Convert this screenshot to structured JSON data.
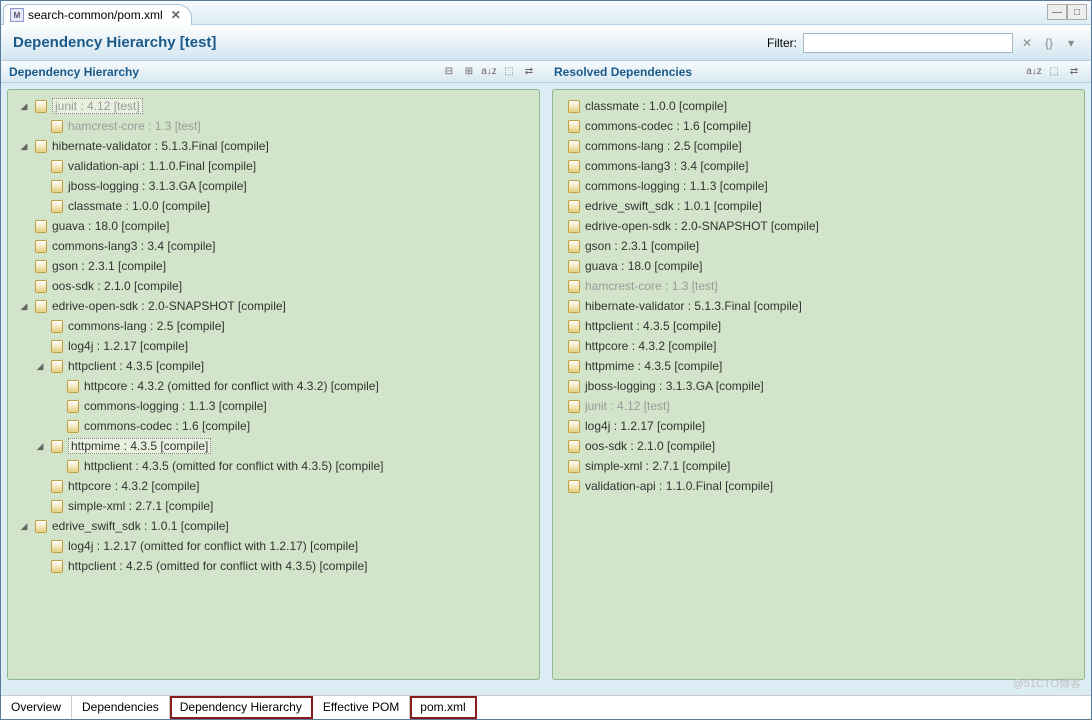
{
  "tab": {
    "icon": "M",
    "name": "search-common/pom.xml",
    "close": "✕"
  },
  "window": {
    "min": "—",
    "max": "□"
  },
  "title": "Dependency Hierarchy [test]",
  "filter": {
    "label": "Filter:",
    "value": "",
    "placeholder": ""
  },
  "filter_icons": [
    "✕",
    "{}",
    "▾"
  ],
  "left": {
    "title": "Dependency Hierarchy",
    "tools": [
      "⊟",
      "⊞",
      "a↓z",
      "⬚",
      "⇄"
    ],
    "tree": [
      {
        "t": "◢",
        "i": 0,
        "l": "junit : 4.12 [test]",
        "g": true,
        "sel": true
      },
      {
        "t": "",
        "i": 1,
        "l": "hamcrest-core : 1.3 [test]",
        "g": true
      },
      {
        "t": "◢",
        "i": 0,
        "l": "hibernate-validator : 5.1.3.Final [compile]"
      },
      {
        "t": "",
        "i": 1,
        "l": "validation-api : 1.1.0.Final [compile]"
      },
      {
        "t": "",
        "i": 1,
        "l": "jboss-logging : 3.1.3.GA [compile]"
      },
      {
        "t": "",
        "i": 1,
        "l": "classmate : 1.0.0 [compile]"
      },
      {
        "t": "",
        "i": 0,
        "l": "guava : 18.0 [compile]"
      },
      {
        "t": "",
        "i": 0,
        "l": "commons-lang3 : 3.4 [compile]"
      },
      {
        "t": "",
        "i": 0,
        "l": "gson : 2.3.1 [compile]"
      },
      {
        "t": "",
        "i": 0,
        "l": "oos-sdk : 2.1.0 [compile]"
      },
      {
        "t": "◢",
        "i": 0,
        "l": "edrive-open-sdk : 2.0-SNAPSHOT [compile]"
      },
      {
        "t": "",
        "i": 1,
        "l": "commons-lang : 2.5 [compile]"
      },
      {
        "t": "",
        "i": 1,
        "l": "log4j : 1.2.17 [compile]"
      },
      {
        "t": "◢",
        "i": 1,
        "l": "httpclient : 4.3.5 [compile]"
      },
      {
        "t": "",
        "i": 2,
        "l": "httpcore : 4.3.2 (omitted for conflict with 4.3.2) [compile]"
      },
      {
        "t": "",
        "i": 2,
        "l": "commons-logging : 1.1.3 [compile]"
      },
      {
        "t": "",
        "i": 2,
        "l": "commons-codec : 1.6 [compile]"
      },
      {
        "t": "◢",
        "i": 1,
        "l": "httpmime : 4.3.5 [compile]",
        "sel": true
      },
      {
        "t": "",
        "i": 2,
        "l": "httpclient : 4.3.5 (omitted for conflict with 4.3.5) [compile]"
      },
      {
        "t": "",
        "i": 1,
        "l": "httpcore : 4.3.2 [compile]"
      },
      {
        "t": "",
        "i": 1,
        "l": "simple-xml : 2.7.1 [compile]"
      },
      {
        "t": "◢",
        "i": 0,
        "l": "edrive_swift_sdk : 1.0.1 [compile]"
      },
      {
        "t": "",
        "i": 1,
        "l": "log4j : 1.2.17 (omitted for conflict with 1.2.17) [compile]"
      },
      {
        "t": "",
        "i": 1,
        "l": "httpclient : 4.2.5 (omitted for conflict with 4.3.5) [compile]"
      }
    ]
  },
  "right": {
    "title": "Resolved Dependencies",
    "tools": [
      "a↓z",
      "⬚",
      "⇄"
    ],
    "list": [
      {
        "l": "classmate : 1.0.0 [compile]"
      },
      {
        "l": "commons-codec : 1.6 [compile]"
      },
      {
        "l": "commons-lang : 2.5 [compile]"
      },
      {
        "l": "commons-lang3 : 3.4 [compile]"
      },
      {
        "l": "commons-logging : 1.1.3 [compile]"
      },
      {
        "l": "edrive_swift_sdk : 1.0.1 [compile]"
      },
      {
        "l": "edrive-open-sdk : 2.0-SNAPSHOT [compile]"
      },
      {
        "l": "gson : 2.3.1 [compile]"
      },
      {
        "l": "guava : 18.0 [compile]"
      },
      {
        "l": "hamcrest-core : 1.3 [test]",
        "g": true
      },
      {
        "l": "hibernate-validator : 5.1.3.Final [compile]"
      },
      {
        "l": "httpclient : 4.3.5 [compile]"
      },
      {
        "l": "httpcore : 4.3.2 [compile]"
      },
      {
        "l": "httpmime : 4.3.5 [compile]"
      },
      {
        "l": "jboss-logging : 3.1.3.GA [compile]"
      },
      {
        "l": "junit : 4.12 [test]",
        "g": true
      },
      {
        "l": "log4j : 1.2.17 [compile]"
      },
      {
        "l": "oos-sdk : 2.1.0 [compile]"
      },
      {
        "l": "simple-xml : 2.7.1 [compile]"
      },
      {
        "l": "validation-api : 1.1.0.Final [compile]"
      }
    ]
  },
  "bottom_tabs": [
    {
      "l": "Overview"
    },
    {
      "l": "Dependencies"
    },
    {
      "l": "Dependency Hierarchy",
      "hl": true
    },
    {
      "l": "Effective POM"
    },
    {
      "l": "pom.xml",
      "hl": true
    }
  ],
  "watermark": "@51CTO博客"
}
